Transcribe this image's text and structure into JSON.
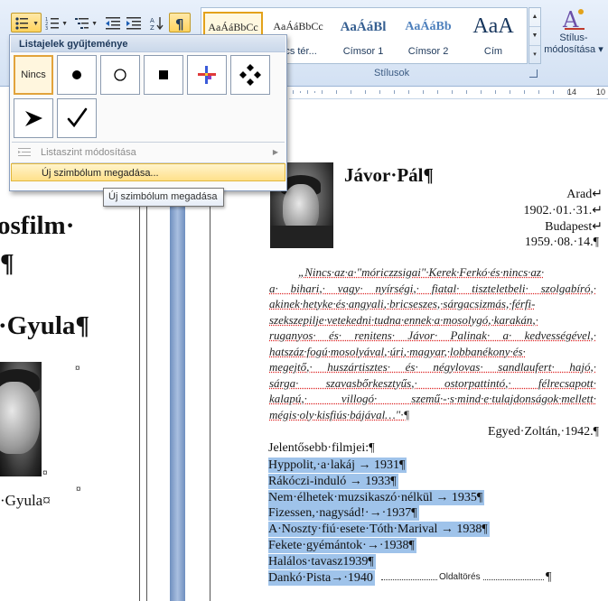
{
  "ribbon": {
    "styles": [
      {
        "sample": "AaÁáBbCc",
        "name": ""
      },
      {
        "sample": "AaÁáBbCc",
        "name": "ncs tér..."
      },
      {
        "sample": "AaÁáBl",
        "name": "Címsor 1"
      },
      {
        "sample": "AaÁáBb",
        "name": "Címsor 2"
      },
      {
        "sample": "AaA",
        "name": "Cím"
      }
    ],
    "styles_group_label": "Stílusok",
    "change_styles_label_1": "Stílus-",
    "change_styles_label_2": "módosítása",
    "change_styles_arrow": "▾"
  },
  "ruler": {
    "marks": [
      "14",
      "10"
    ]
  },
  "dropdown": {
    "header": "Listajelek gyűjteménye",
    "none_label": "Nincs",
    "bullets": [
      "filled-circle",
      "hollow-circle",
      "filled-square",
      "color-cross",
      "four-diamonds",
      "arrowhead",
      "checkmark"
    ],
    "change_level": "Listaszint módosítása",
    "define_symbol": "Új szimbólum megadása..."
  },
  "tooltip": "Új szimbólum megadása",
  "left_page": {
    "line1": "osfilm·",
    "line2": "i¶",
    "line3": "·Gyula¶",
    "caption": "·Gyula¤",
    "cell_mark": "¤",
    "cell_mark2": "¤"
  },
  "right_page": {
    "name": "Jávor·Pál¶",
    "birth_place": "Arad↵",
    "birth_date": "1902.·01.·31.↵",
    "death_place": "Budapest↵",
    "death_date": "1959.·08.·14.¶",
    "quote_lines": [
      "„Nincs·az·a·\"móriczzsigai\"·Kerek·Ferkó·és·nincs·az·",
      "a· bihari,· vagy· nyírségi,· fiatal· tiszteletbeli· szolgabíró,·",
      "akinek·hetyke·és·angyali,·bricseszes,·sárgacsizmás,·férfi-",
      "szekszepilje·vetekedni·tudna·ennek·a·mosolygó,·karakán,·",
      "ruganyos· és· renitens· Jávor· Palinak· a· kedvességével,·",
      "hatszáz·fogú·mosolyával,·úri,·magyar,·lobbanékony·és·",
      "megejtő,· huszártisztes· és· négylovas· sandlaufert· hajó,·",
      "sárga· szavasbőrkesztyűs,· ostorpattintó,· félrecsapott·",
      "kalapú,· villogó· szemű·-·s·mind·e·tulajdonságok·mellett·",
      "mégis·oly·kisfiús·bájával…\"·¶"
    ],
    "quote_author": "Egyed·Zoltán,·1942.¶",
    "films_heading": "Jelentősebb·filmjei:¶",
    "films": [
      "Hyppolit,·a·lakáj  →  1931¶",
      "Rákóczi-induló  →  1933¶",
      "Nem·élhetek·muzsikaszó·nélkül  →  1935¶",
      "Fizessen,·nagysád!·→·1937¶",
      "A·Noszty·fiú·esete·Tóth·Marival  →  1938¶",
      "Fekete·gyémántok·→·1938¶",
      "Halálos·tavasz1939¶",
      "Dankó·Pista→·1940"
    ],
    "page_break": "Oldaltörés",
    "page_break_mark": "¶"
  }
}
